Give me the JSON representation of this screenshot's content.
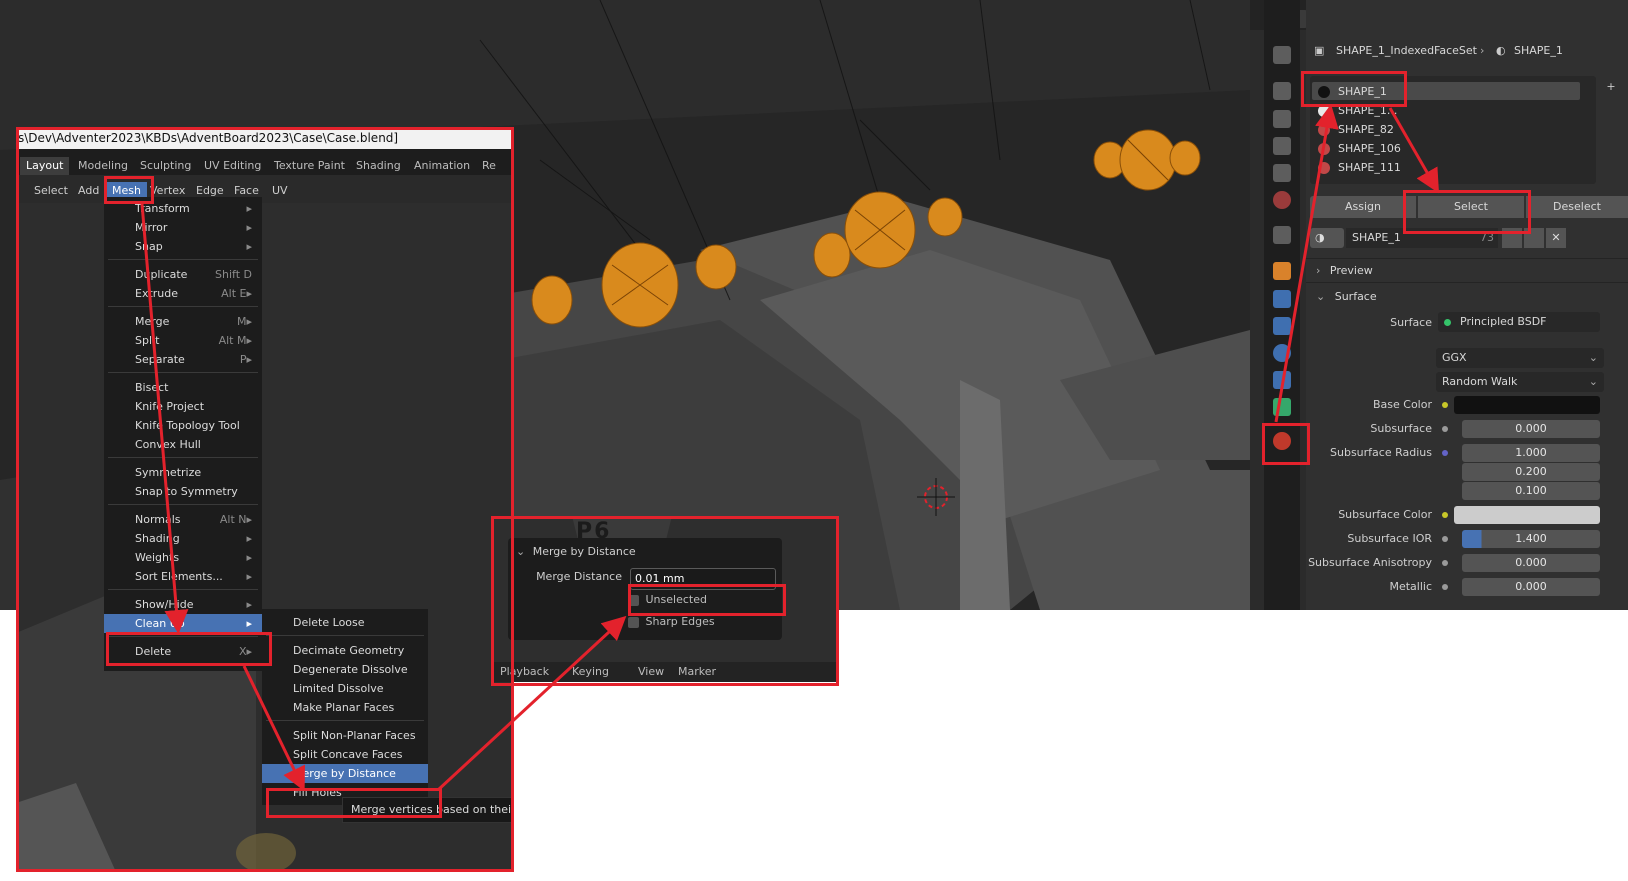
{
  "file_path": "s\\Dev\\Adventer2023\\KBDs\\AdventBoard2023\\Case\\Case.blend]",
  "workspace_tabs": [
    "Layout",
    "Modeling",
    "Sculpting",
    "UV Editing",
    "Texture Paint",
    "Shading",
    "Animation",
    "Re"
  ],
  "header_menu": [
    "Select",
    "Add",
    "Mesh",
    "Vertex",
    "Edge",
    "Face",
    "UV"
  ],
  "mesh_menu": [
    {
      "label": "Transform",
      "shortcut": "▸"
    },
    {
      "label": "Mirror",
      "shortcut": "▸"
    },
    {
      "label": "Snap",
      "shortcut": "▸"
    },
    {
      "label": "Duplicate",
      "shortcut": "Shift D"
    },
    {
      "label": "Extrude",
      "shortcut": "Alt E▸"
    },
    {
      "label": "Merge",
      "shortcut": "M▸"
    },
    {
      "label": "Split",
      "shortcut": "Alt M▸"
    },
    {
      "label": "Separate",
      "shortcut": "P▸"
    },
    {
      "label": "Bisect",
      "shortcut": ""
    },
    {
      "label": "Knife Project",
      "shortcut": ""
    },
    {
      "label": "Knife Topology Tool",
      "shortcut": ""
    },
    {
      "label": "Convex Hull",
      "shortcut": ""
    },
    {
      "label": "Symmetrize",
      "shortcut": ""
    },
    {
      "label": "Snap to Symmetry",
      "shortcut": ""
    },
    {
      "label": "Normals",
      "shortcut": "Alt N▸"
    },
    {
      "label": "Shading",
      "shortcut": "▸"
    },
    {
      "label": "Weights",
      "shortcut": "▸"
    },
    {
      "label": "Sort Elements...",
      "shortcut": "▸"
    },
    {
      "label": "Show/Hide",
      "shortcut": "▸"
    },
    {
      "label": "Clean Up",
      "shortcut": "▸"
    },
    {
      "label": "Delete",
      "shortcut": "X▸"
    }
  ],
  "cleanup_menu": [
    "Delete Loose",
    "Decimate Geometry",
    "Degenerate Dissolve",
    "Limited Dissolve",
    "Make Planar Faces",
    "Split Non-Planar Faces",
    "Split Concave Faces",
    "Merge by Distance",
    "Fill Holes"
  ],
  "tooltip": "Merge vertices based on thei",
  "merge_panel": {
    "title": "Merge by Distance",
    "distance_label": "Merge Distance",
    "distance_value": "0.01 mm",
    "unselected": "Unselected",
    "sharp_edges": "Sharp Edges",
    "timeline": [
      "Playback",
      "Keying",
      "View",
      "Marker"
    ]
  },
  "viewport_text": "P6",
  "properties": {
    "breadcrumb_object": "SHAPE_1_IndexedFaceSet",
    "breadcrumb_material": "SHAPE_1",
    "material_slots": [
      "SHAPE_1",
      "SHAPE_1...",
      "SHAPE_82",
      "SHAPE_106",
      "SHAPE_111"
    ],
    "buttons": {
      "assign": "Assign",
      "select": "Select",
      "deselect": "Deselect"
    },
    "material_name": "SHAPE_1",
    "user_count": "73",
    "preview_label": "Preview",
    "surface_section": "Surface",
    "surface_label": "Surface",
    "surface_shader": "Principled BSDF",
    "distribution": "GGX",
    "subsurface_method": "Random Walk",
    "rows": [
      {
        "label": "Base Color",
        "value": ""
      },
      {
        "label": "Subsurface",
        "value": "0.000"
      },
      {
        "label": "Subsurface Radius",
        "value": "1.000"
      },
      {
        "label": "",
        "value": "0.200"
      },
      {
        "label": "",
        "value": "0.100"
      },
      {
        "label": "Subsurface Color",
        "value": ""
      },
      {
        "label": "Subsurface IOR",
        "value": "1.400"
      },
      {
        "label": "Subsurface Anisotropy",
        "value": "0.000"
      },
      {
        "label": "Metallic",
        "value": "0.000"
      }
    ],
    "colors": {
      "base_color": "#111111",
      "subsurface_color": "#cccccc",
      "ior_fill": "#4772b3"
    }
  },
  "accent": "#e3222c",
  "highlight": "#4772b3"
}
